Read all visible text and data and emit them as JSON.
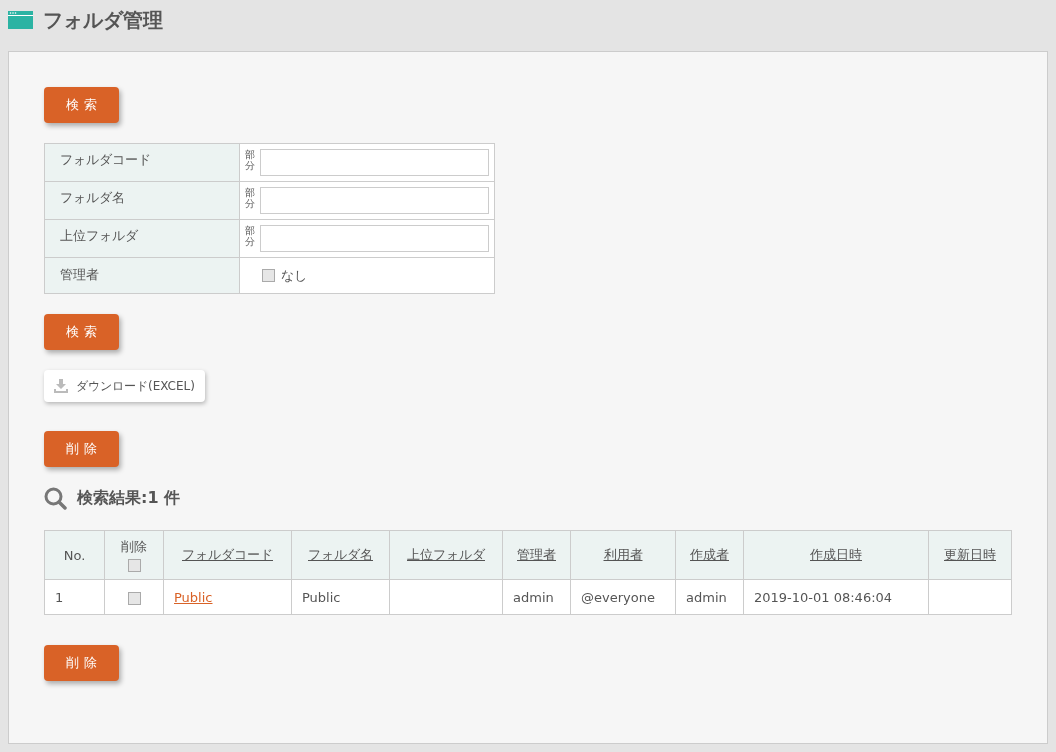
{
  "page": {
    "title": "フォルダ管理"
  },
  "buttons_top": [
    {
      "label": "検 索"
    }
  ],
  "search_form": {
    "fields": [
      {
        "kind": "text",
        "label": "フォルダコード",
        "mode": "部分"
      },
      {
        "kind": "text",
        "label": "フォルダ名",
        "mode": "部分"
      },
      {
        "kind": "text",
        "label": "上位フォルダ",
        "mode": "部分"
      },
      {
        "kind": "checkbox",
        "label": "管理者",
        "option": "なし",
        "checked": false
      }
    ]
  },
  "buttons_middle": [
    {
      "label": "検 索"
    }
  ],
  "download_button": {
    "label": "ダウンロード(EXCEL)"
  },
  "buttons_delete_top": [
    {
      "label": "削 除"
    }
  ],
  "results": {
    "heading": "検索結果:1 件",
    "columns": [
      {
        "kind": "text",
        "label": "No."
      },
      {
        "kind": "checkbox",
        "label": "削除",
        "checked": false
      },
      {
        "kind": "sort",
        "label": "フォルダコード"
      },
      {
        "kind": "sort",
        "label": "フォルダ名"
      },
      {
        "kind": "sort",
        "label": "上位フォルダ"
      },
      {
        "kind": "sort",
        "label": "管理者"
      },
      {
        "kind": "sort",
        "label": "利用者"
      },
      {
        "kind": "sort",
        "label": "作成者"
      },
      {
        "kind": "sort",
        "label": "作成日時"
      },
      {
        "kind": "sort",
        "label": "更新日時"
      }
    ],
    "rows": [
      {
        "cells": [
          {
            "kind": "text",
            "text": "1"
          },
          {
            "kind": "checkbox",
            "checked": false
          },
          {
            "kind": "link",
            "text": "Public"
          },
          {
            "kind": "text",
            "text": "Public"
          },
          {
            "kind": "empty"
          },
          {
            "kind": "text",
            "text": "admin"
          },
          {
            "kind": "text",
            "text": "@everyone"
          },
          {
            "kind": "text",
            "text": "admin"
          },
          {
            "kind": "text",
            "text": "2019-10-01 08:46:04"
          },
          {
            "kind": "empty"
          }
        ]
      }
    ]
  },
  "buttons_delete_bottom": [
    {
      "label": "削 除"
    }
  ]
}
